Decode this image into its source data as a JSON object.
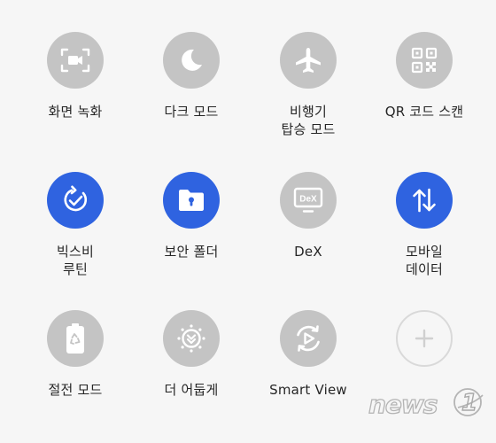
{
  "tiles": [
    {
      "label": "화면 녹화",
      "icon": "screen-record-icon",
      "state": "off"
    },
    {
      "label": "다크 모드",
      "icon": "moon-icon",
      "state": "off"
    },
    {
      "label": "비행기\n탑승 모드",
      "icon": "airplane-icon",
      "state": "off"
    },
    {
      "label": "QR 코드 스캔",
      "icon": "qr-code-icon",
      "state": "off"
    },
    {
      "label": "빅스비\n루틴",
      "icon": "bixby-routines-icon",
      "state": "on"
    },
    {
      "label": "보안 폴더",
      "icon": "secure-folder-icon",
      "state": "on"
    },
    {
      "label": "DeX",
      "icon": "dex-icon",
      "state": "off"
    },
    {
      "label": "모바일\n데이터",
      "icon": "mobile-data-icon",
      "state": "on"
    },
    {
      "label": "절전 모드",
      "icon": "power-saving-icon",
      "state": "off"
    },
    {
      "label": "더 어둡게",
      "icon": "extra-dim-icon",
      "state": "off"
    },
    {
      "label": "Smart View",
      "icon": "smart-view-icon",
      "state": "off"
    },
    {
      "label": "",
      "icon": "plus-icon",
      "state": "add"
    }
  ],
  "colors": {
    "active": "#2f63e0",
    "inactive": "#c4c4c4",
    "background": "#f6f6f6"
  },
  "watermark": {
    "text": "news",
    "number": "1"
  }
}
